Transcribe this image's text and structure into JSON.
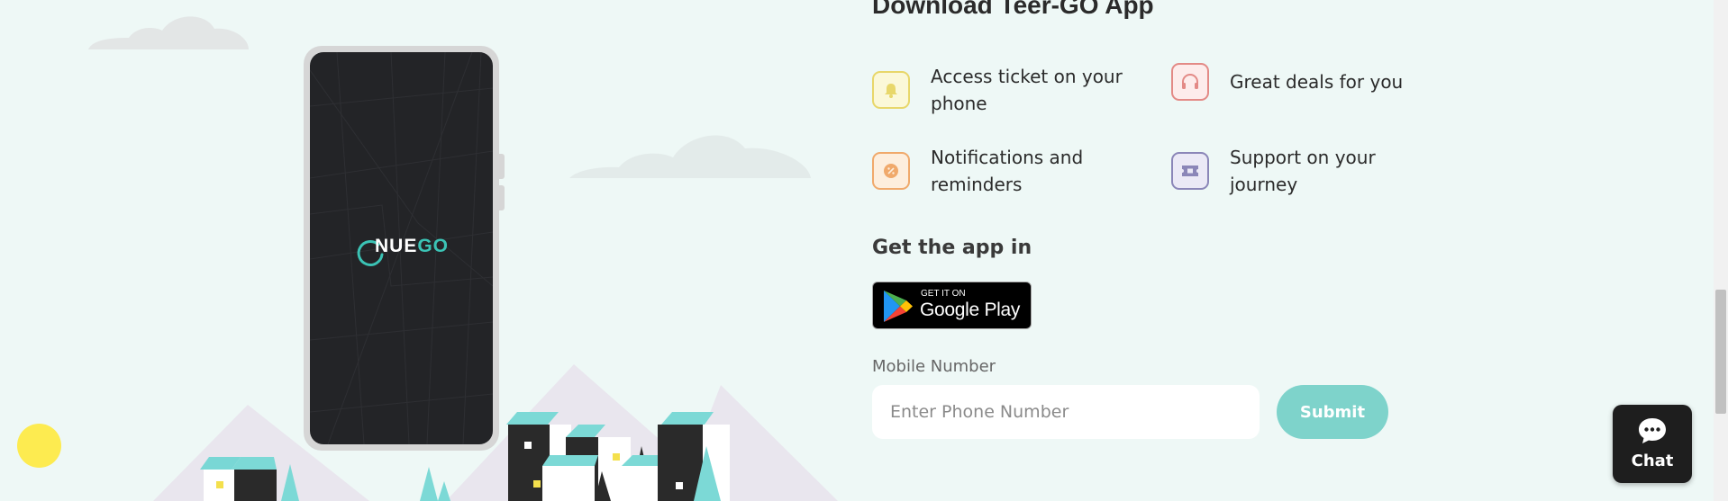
{
  "section": {
    "title": "Download Teer-GO App"
  },
  "phone_mockup": {
    "logo_text_1": "NUE",
    "logo_text_2": "GO"
  },
  "features": [
    {
      "label": "Access ticket on your phone",
      "icon": "bell-icon",
      "color": "#e8d76a",
      "bg": "#fbf8d8"
    },
    {
      "label": "Great deals for you",
      "icon": "headphones-icon",
      "color": "#e38a86",
      "bg": "#fdeceb"
    },
    {
      "label": "Notifications and reminders",
      "icon": "badge-icon",
      "color": "#f0a96b",
      "bg": "#fdeedd"
    },
    {
      "label": "Support on your journey",
      "icon": "ticket-icon",
      "color": "#8b86b8",
      "bg": "#ebe9f6"
    }
  ],
  "get_app": {
    "heading": "Get the app in",
    "store_small": "GET IT ON",
    "store_big": "Google Play"
  },
  "mobile_form": {
    "label": "Mobile Number",
    "placeholder": "Enter Phone Number",
    "submit_label": "Submit"
  },
  "chat_widget": {
    "label": "Chat"
  },
  "colors": {
    "background": "#eef8f6",
    "accent": "#7ed3cb",
    "brand_teal": "#3bc3b5",
    "sun": "#fdeb50"
  }
}
